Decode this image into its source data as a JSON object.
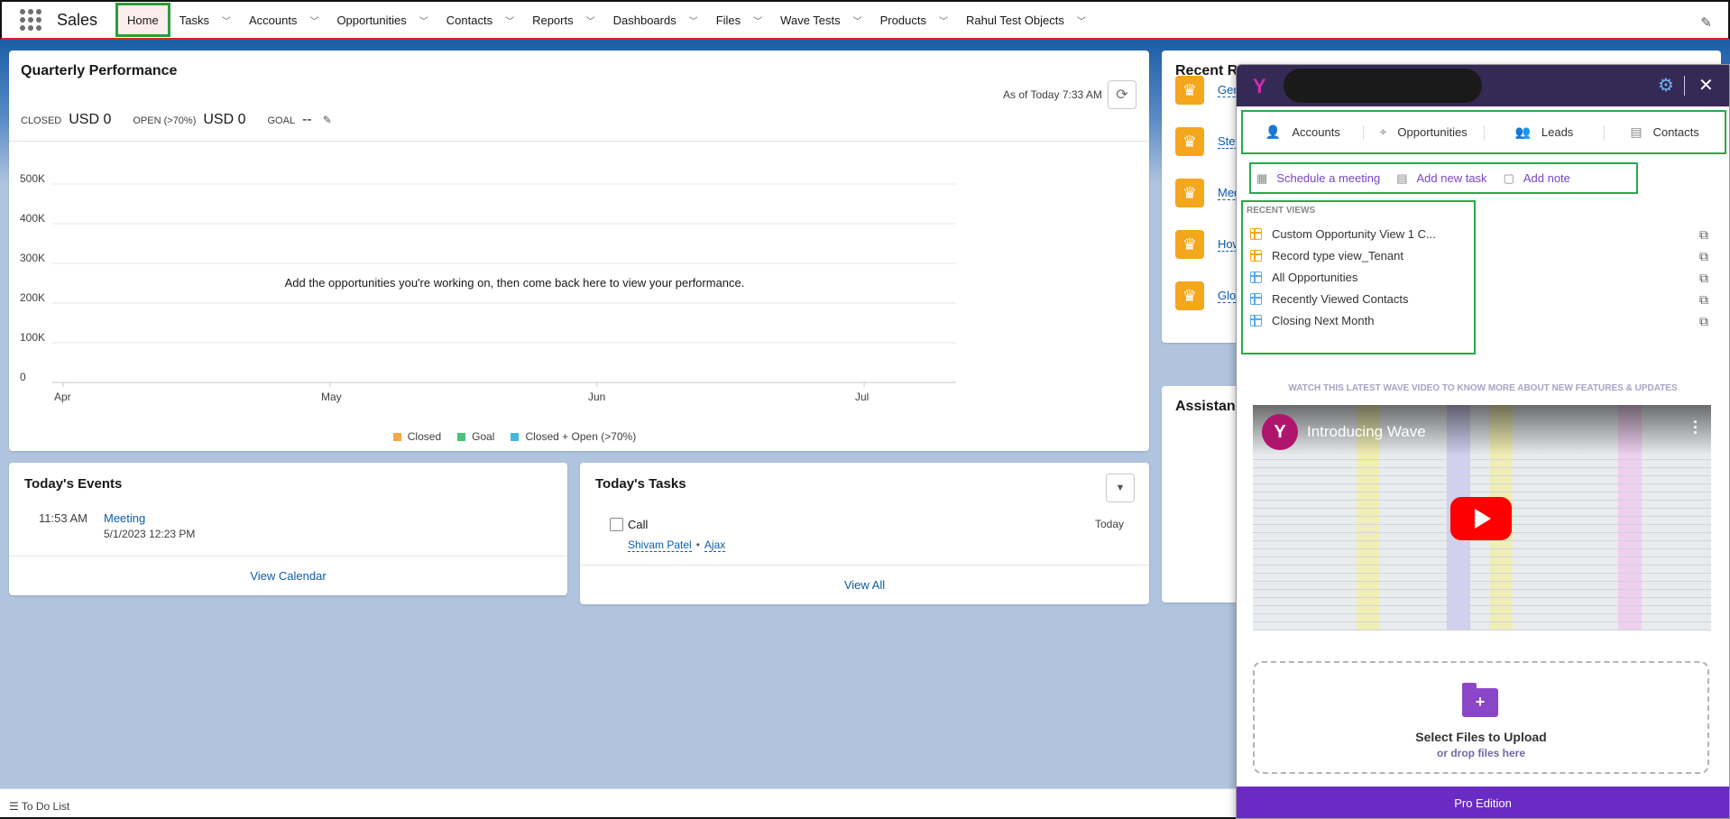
{
  "nav": {
    "app_name": "Sales",
    "items": [
      {
        "label": "Home",
        "active": true,
        "chevron": false
      },
      {
        "label": "Tasks",
        "chevron": true
      },
      {
        "label": "Accounts",
        "chevron": true
      },
      {
        "label": "Opportunities",
        "chevron": true
      },
      {
        "label": "Contacts",
        "chevron": true
      },
      {
        "label": "Reports",
        "chevron": true
      },
      {
        "label": "Dashboards",
        "chevron": true
      },
      {
        "label": "Files",
        "chevron": true
      },
      {
        "label": "Wave Tests",
        "chevron": true
      },
      {
        "label": "Products",
        "chevron": true
      },
      {
        "label": "Rahul Test Objects",
        "chevron": true
      }
    ]
  },
  "quarterly": {
    "title": "Quarterly Performance",
    "as_of": "As of Today 7:33 AM",
    "closed_label": "CLOSED",
    "closed_value": "USD 0",
    "open_label": "OPEN (>70%)",
    "open_value": "USD 0",
    "goal_label": "GOAL",
    "goal_value": "--",
    "empty_message": "Add the opportunities you're working on, then come back here to view your performance."
  },
  "chart_data": {
    "type": "line",
    "categories": [
      "Apr",
      "May",
      "Jun",
      "Jul"
    ],
    "y_ticks": [
      "0",
      "100K",
      "200K",
      "300K",
      "400K",
      "500K"
    ],
    "ylim": [
      0,
      500000
    ],
    "grid": true,
    "legend_position": "bottom",
    "series": [
      {
        "name": "Closed",
        "color": "#f4a64a",
        "values": []
      },
      {
        "name": "Goal",
        "color": "#4bc076",
        "values": []
      },
      {
        "name": "Closed + Open (>70%)",
        "color": "#3fb8e4",
        "values": []
      }
    ]
  },
  "events": {
    "title": "Today's Events",
    "time": "11:53 AM",
    "event_title": "Meeting",
    "event_date": "5/1/2023 12:23 PM",
    "footer": "View Calendar"
  },
  "tasks": {
    "title": "Today's Tasks",
    "task_name": "Call",
    "due": "Today",
    "link1": "Shivam Patel",
    "link2": "Ajax",
    "footer": "View All"
  },
  "recent_records": {
    "title": "Recent R",
    "links": [
      "Gen",
      "Stev",
      "Med",
      "How",
      "Glo"
    ]
  },
  "assistant": {
    "title": "Assistant"
  },
  "todo": {
    "label": "To Do List"
  },
  "wave": {
    "tabs": [
      {
        "label": "Accounts",
        "icon": "person-icon"
      },
      {
        "label": "Opportunities",
        "icon": "map-pin-icon"
      },
      {
        "label": "Leads",
        "icon": "people-icon"
      },
      {
        "label": "Contacts",
        "icon": "contact-card-icon"
      }
    ],
    "actions": [
      {
        "label": "Schedule a meeting",
        "icon": "calendar-icon"
      },
      {
        "label": "Add new task",
        "icon": "task-icon"
      },
      {
        "label": "Add note",
        "icon": "note-icon"
      }
    ],
    "recent_header": "RECENT VIEWS",
    "recent_views": [
      {
        "label": "Custom Opportunity View 1 C...",
        "color": "#f4a61c"
      },
      {
        "label": "Record type view_Tenant",
        "color": "#f4a61c"
      },
      {
        "label": "All Opportunities",
        "color": "#5aa9e6"
      },
      {
        "label": "Recently Viewed Contacts",
        "color": "#5aa9e6"
      },
      {
        "label": "Closing Next Month",
        "color": "#5aa9e6"
      }
    ],
    "video_caption": "WATCH THIS LATEST WAVE VIDEO TO KNOW MORE ABOUT NEW FEATURES & UPDATES",
    "video_title": "Introducing Wave",
    "upload_title": "Select Files to Upload",
    "upload_sub": "or drop files here",
    "footer": "Pro Edition"
  }
}
